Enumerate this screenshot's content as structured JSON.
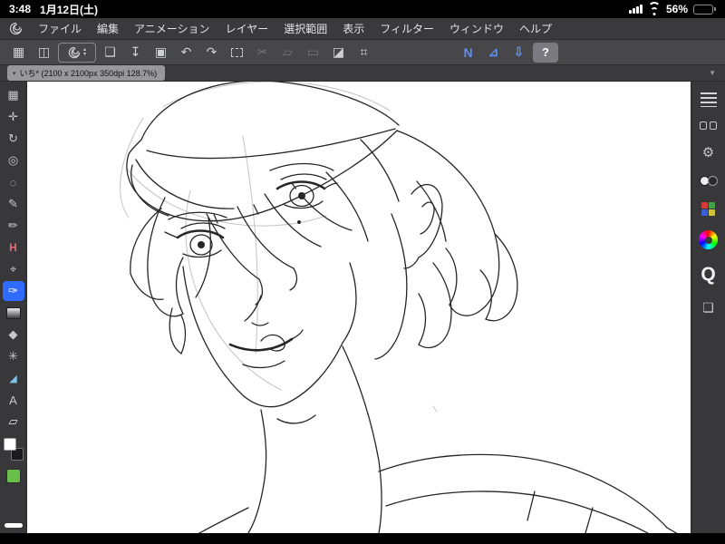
{
  "status_bar": {
    "time": "3:48",
    "date": "1月12日(土)",
    "battery_percent": "56%"
  },
  "menu_bar": {
    "items": [
      "ファイル",
      "編集",
      "アニメーション",
      "レイヤー",
      "選択範囲",
      "表示",
      "フィルター",
      "ウィンドウ",
      "ヘルプ"
    ]
  },
  "main_toolbar": {
    "chevron_up": "▴",
    "chevron_down": "▾",
    "buttons": [
      {
        "name": "workspace-grid",
        "glyph": "▦"
      },
      {
        "name": "screen-share",
        "glyph": "◫"
      },
      {
        "name": "clip-studio-launcher",
        "glyph": ""
      },
      {
        "name": "new-canvas",
        "glyph": "❏"
      },
      {
        "name": "save",
        "glyph": "↧"
      },
      {
        "name": "publish",
        "glyph": "▣"
      },
      {
        "name": "undo",
        "glyph": "↶"
      },
      {
        "name": "redo",
        "glyph": "↷"
      },
      {
        "name": "select-area",
        "glyph": ""
      },
      {
        "name": "cut",
        "glyph": "✂"
      },
      {
        "name": "copy",
        "glyph": "▱"
      },
      {
        "name": "paste",
        "glyph": "▭"
      },
      {
        "name": "fill",
        "glyph": "◪"
      },
      {
        "name": "frame",
        "glyph": "⌗"
      },
      {
        "name": "n-tool",
        "glyph": "N"
      },
      {
        "name": "perspective-ruler",
        "glyph": "⊿"
      },
      {
        "name": "import-download",
        "glyph": "⇩"
      },
      {
        "name": "help",
        "glyph": "?"
      }
    ]
  },
  "document_tab": {
    "caret": "▾",
    "label": "いち* (2100 x 2100px 350dpi 128.7%)",
    "overflow_caret": "▼"
  },
  "left_toolbar": {
    "tools": [
      {
        "name": "workspace",
        "glyph": "▦"
      },
      {
        "name": "hand",
        "glyph": "✛"
      },
      {
        "name": "rotate",
        "glyph": "↻"
      },
      {
        "name": "zoom",
        "glyph": "◎"
      },
      {
        "name": "lasso",
        "glyph": "◌"
      },
      {
        "name": "pen",
        "glyph": "✎"
      },
      {
        "name": "pencil",
        "glyph": "✏"
      },
      {
        "name": "marker",
        "glyph": "H"
      },
      {
        "name": "operation",
        "glyph": "⌖"
      },
      {
        "name": "airbrush",
        "glyph": "✑"
      },
      {
        "name": "gradient",
        "glyph": ""
      },
      {
        "name": "blend",
        "glyph": "◆"
      },
      {
        "name": "decoration",
        "glyph": "✳"
      },
      {
        "name": "figure",
        "glyph": "◢"
      },
      {
        "name": "text",
        "glyph": "A"
      },
      {
        "name": "eraser",
        "glyph": "▱"
      }
    ]
  },
  "right_toolbar": {
    "tool_property_glyph": "⚙",
    "material_glyph": "❏",
    "quick_access_label": "Q"
  },
  "colors": {
    "accent_blue": "#5e8ef0",
    "selected_tool_bg": "#2f6bff",
    "marker_pink": "#e06b7d",
    "figure_blue": "#7fc4e8",
    "swatch_green": "#6abf4b"
  }
}
